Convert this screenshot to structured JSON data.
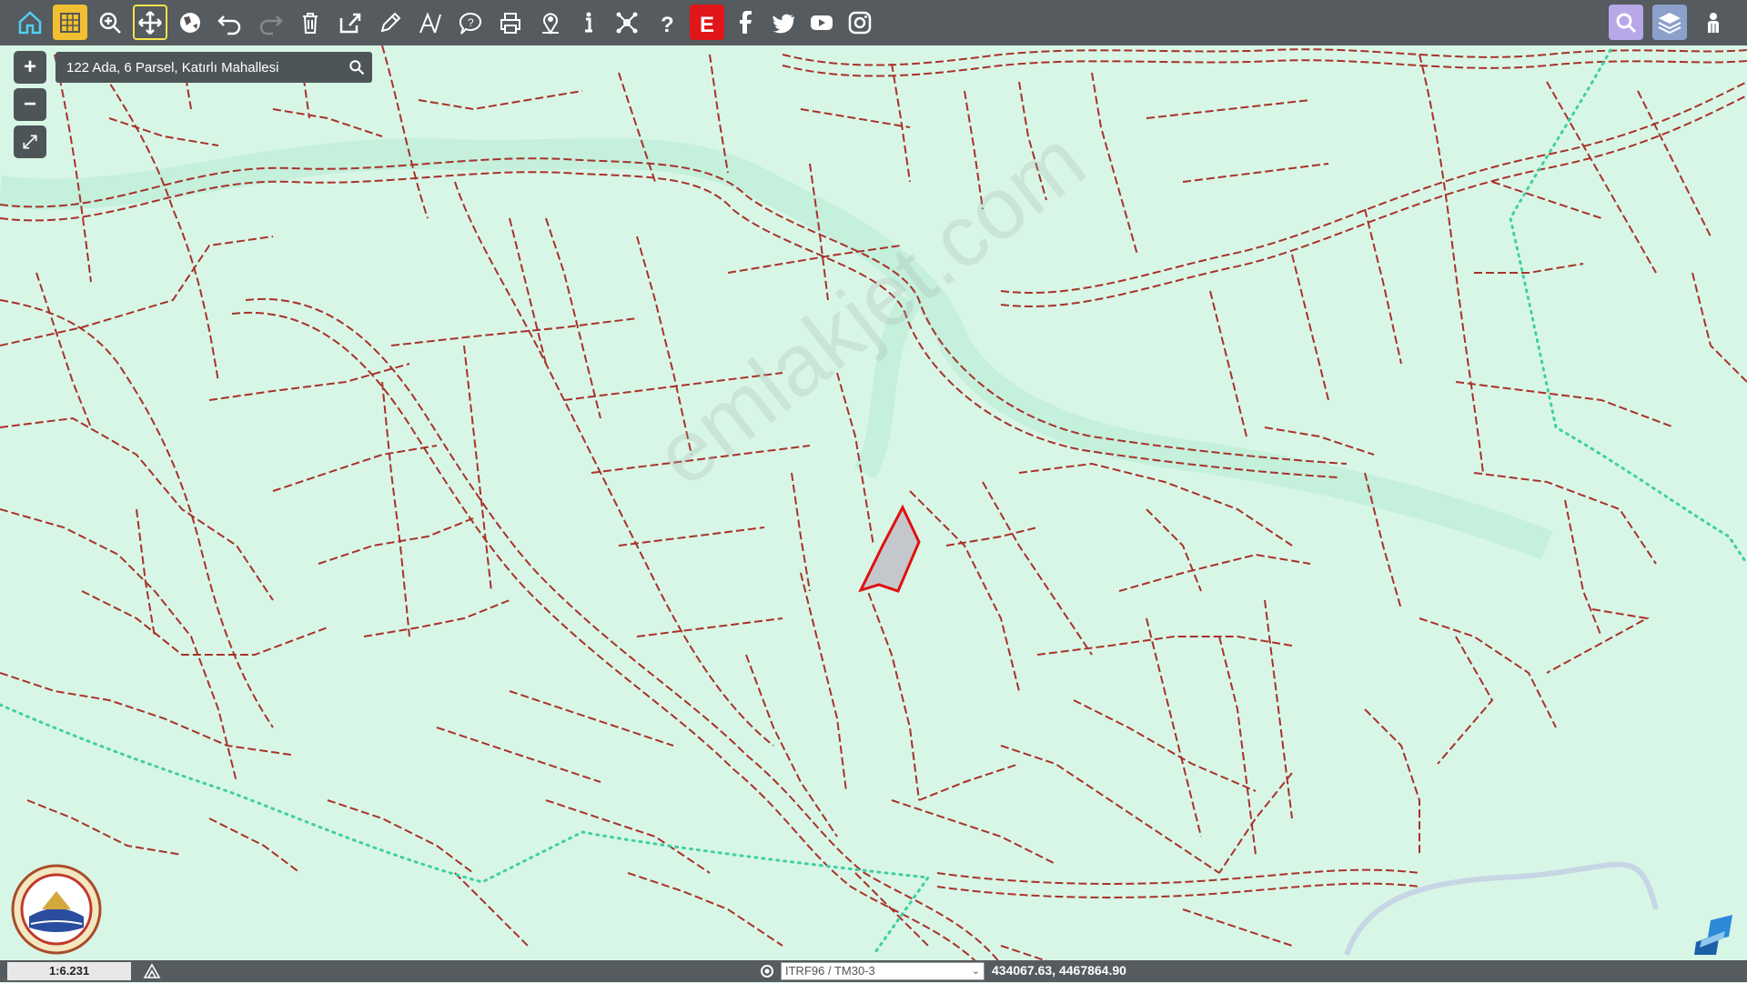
{
  "search": {
    "value": "122 Ada, 6 Parsel, Katırlı Mahallesi"
  },
  "toolbar": {
    "left_tools": [
      {
        "name": "home-icon"
      },
      {
        "name": "grid-icon"
      },
      {
        "name": "zoom-in-icon"
      },
      {
        "name": "pan-icon"
      },
      {
        "name": "globe-icon"
      },
      {
        "name": "undo-icon"
      },
      {
        "name": "redo-icon"
      },
      {
        "name": "trash-icon"
      },
      {
        "name": "share-icon"
      },
      {
        "name": "pencil-icon"
      },
      {
        "name": "measure-area-icon"
      },
      {
        "name": "help-bubble-icon"
      },
      {
        "name": "print-icon"
      },
      {
        "name": "location-pin-icon"
      },
      {
        "name": "info-icon"
      },
      {
        "name": "network-icon"
      },
      {
        "name": "question-icon"
      },
      {
        "name": "e-devlet-icon"
      },
      {
        "name": "facebook-icon"
      },
      {
        "name": "twitter-icon"
      },
      {
        "name": "youtube-icon"
      },
      {
        "name": "instagram-icon"
      }
    ],
    "right_tools": [
      {
        "name": "search-icon"
      },
      {
        "name": "layers-icon"
      },
      {
        "name": "user-icon"
      }
    ]
  },
  "zoom": {
    "plus": "+",
    "minus": "−"
  },
  "statusbar": {
    "scale": "1:6.231",
    "crs": "ITRF96 / TM30-3",
    "coordinates": "434067.63, 4467864.90"
  },
  "watermark": "emlakjet.com",
  "colors": {
    "map_bg": "#d8f6e6",
    "parcel_line": "#a8322a",
    "selected_fill": "#c4c8cc",
    "selected_stroke": "#e01010",
    "boundary_dotted": "#3fd0a0",
    "toolbar_bg": "#555b5f"
  }
}
